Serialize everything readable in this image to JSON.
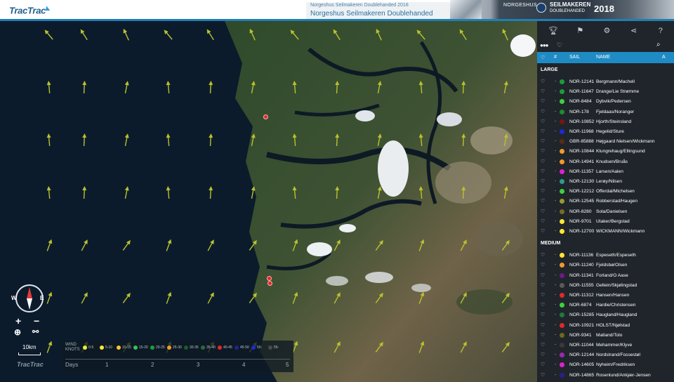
{
  "header": {
    "logo": "TracTrac",
    "title_small": "Norgeshus Seilmakeren Doublehanded 2018",
    "title_big": "Norgeshus Seilmakeren Doublehanded",
    "banner_brand": "NORGESHUS",
    "banner_event_1": "SEILMAKEREN",
    "banner_event_2": "DOUBLEHANDED",
    "banner_year": "2018"
  },
  "map_controls": {
    "compass_w": "W",
    "compass_e": "E",
    "zoom_in": "+",
    "zoom_out": "−",
    "scale": "10km",
    "footer_logo": "TracTrac"
  },
  "legend": {
    "wind_label_1": "WIND",
    "wind_label_2": "KNOTS",
    "wind_classes": [
      {
        "label": "0-5",
        "color": "#e8f03a"
      },
      {
        "label": "5-10",
        "color": "#ffe830"
      },
      {
        "label": "10-15",
        "color": "#f5c730"
      },
      {
        "label": "15-20",
        "color": "#33c15a"
      },
      {
        "label": "20-25",
        "color": "#1e9b3c"
      },
      {
        "label": "25-30",
        "color": "#f29a2a"
      },
      {
        "label": "30-35",
        "color": "#1b5a2a"
      },
      {
        "label": "35-40",
        "color": "#2c6a3a"
      },
      {
        "label": "40-45",
        "color": "#e0282c"
      },
      {
        "label": "45-50",
        "color": "#2a1f8f"
      },
      {
        "label": "50-",
        "color": "#1a2bd6"
      },
      {
        "label": "55-",
        "color": "#4a4a4a"
      }
    ],
    "days_label": "Days",
    "days": [
      "1",
      "2",
      "3",
      "4",
      "5"
    ],
    "progress": 0.0
  },
  "panel": {
    "tools": [
      "trophy-icon",
      "wind-icon",
      "settings-icon",
      "share-icon",
      "help-icon"
    ],
    "col_sail": "SAIL",
    "col_name": "NAME",
    "col_rank": "#",
    "col_extra": "A",
    "groups": [
      {
        "label": "LARGE",
        "rows": [
          {
            "sail": "NOR-12141",
            "name": "Bergmann/Machell",
            "color": "#1e9b3c"
          },
          {
            "sail": "NOR-11647",
            "name": "Drange/Lie Strømme",
            "color": "#1e9b3c"
          },
          {
            "sail": "NOR-8484",
            "name": "Dybvik/Pedersen",
            "color": "#3cd33c"
          },
          {
            "sail": "NOR-178",
            "name": "Fjeldaas/Noranger",
            "color": "#1e8b2c"
          },
          {
            "sail": "NOR-10852",
            "name": "Hjorth/Steinsland",
            "color": "#7a1414"
          },
          {
            "sail": "NOR-11968",
            "name": "Hegelid/Sture",
            "color": "#1a2bd6"
          },
          {
            "sail": "GBR-85888",
            "name": "Højgaard Nielsen/Wickmann",
            "color": "#5a2a1a"
          },
          {
            "sail": "NOR-10844",
            "name": "Klungrehaug/Ellingsund",
            "color": "#f29a2a"
          },
          {
            "sail": "NOR-14941",
            "name": "Knudsen/Bruås",
            "color": "#f29a2a"
          },
          {
            "sail": "NOR-11357",
            "name": "Larsen/Aalen",
            "color": "#e020d0"
          },
          {
            "sail": "NOR-12130",
            "name": "Lerøy/Nilsen",
            "color": "#2a9d8f"
          },
          {
            "sail": "NOR-12212",
            "name": "Offerdal/Michelsen",
            "color": "#3cd33c"
          },
          {
            "sail": "NOR-12545",
            "name": "Robberstad/Haugen",
            "color": "#9a9a2a"
          },
          {
            "sail": "NOR-8280",
            "name": "Sola/Danielsen",
            "color": "#7a6a2a"
          },
          {
            "sail": "NOR-9701",
            "name": "Utaker/Bergstad",
            "color": "#ffe830"
          },
          {
            "sail": "NOR-12700",
            "name": "WICKMANN/Wickmann",
            "color": "#ffe830"
          }
        ]
      },
      {
        "label": "MEDIUM",
        "rows": [
          {
            "sail": "NOR-11136",
            "name": "Espeseth/Espeseth",
            "color": "#ffe830"
          },
          {
            "sail": "NOR-11240",
            "name": "Fjeldsbø/Olsen",
            "color": "#f29a2a"
          },
          {
            "sail": "NOR-11341",
            "name": "Forland/O Aase",
            "color": "#6a1a8a"
          },
          {
            "sail": "NOR-11555",
            "name": "Gellein/Skjølingstad",
            "color": "#5a5a5a"
          },
          {
            "sail": "NOR-11312",
            "name": "Hansen/Hansen",
            "color": "#e0282c"
          },
          {
            "sail": "NOR-6874",
            "name": "Hardie/Christensen",
            "color": "#3cd33c"
          },
          {
            "sail": "NOR-15285",
            "name": "Haugland/Haugland",
            "color": "#1e7b3c"
          },
          {
            "sail": "NOR-10921",
            "name": "HOLST/Njølstad",
            "color": "#e0282c"
          },
          {
            "sail": "NOR-9341",
            "name": "Matland/Tolo",
            "color": "#6a6a1a"
          },
          {
            "sail": "NOR-11044",
            "name": "Mehammer/Klyve",
            "color": "#3a3a3a"
          },
          {
            "sail": "NOR-12144",
            "name": "Nordstrand/Fossestøl",
            "color": "#9a2ab0"
          },
          {
            "sail": "NOR-14605",
            "name": "Nyheim/Fredriksen",
            "color": "#e020d0"
          },
          {
            "sail": "NOR-14865",
            "name": "Rosenlund/Ankjær-Jensen",
            "color": "#2a1f8f"
          }
        ]
      }
    ]
  }
}
